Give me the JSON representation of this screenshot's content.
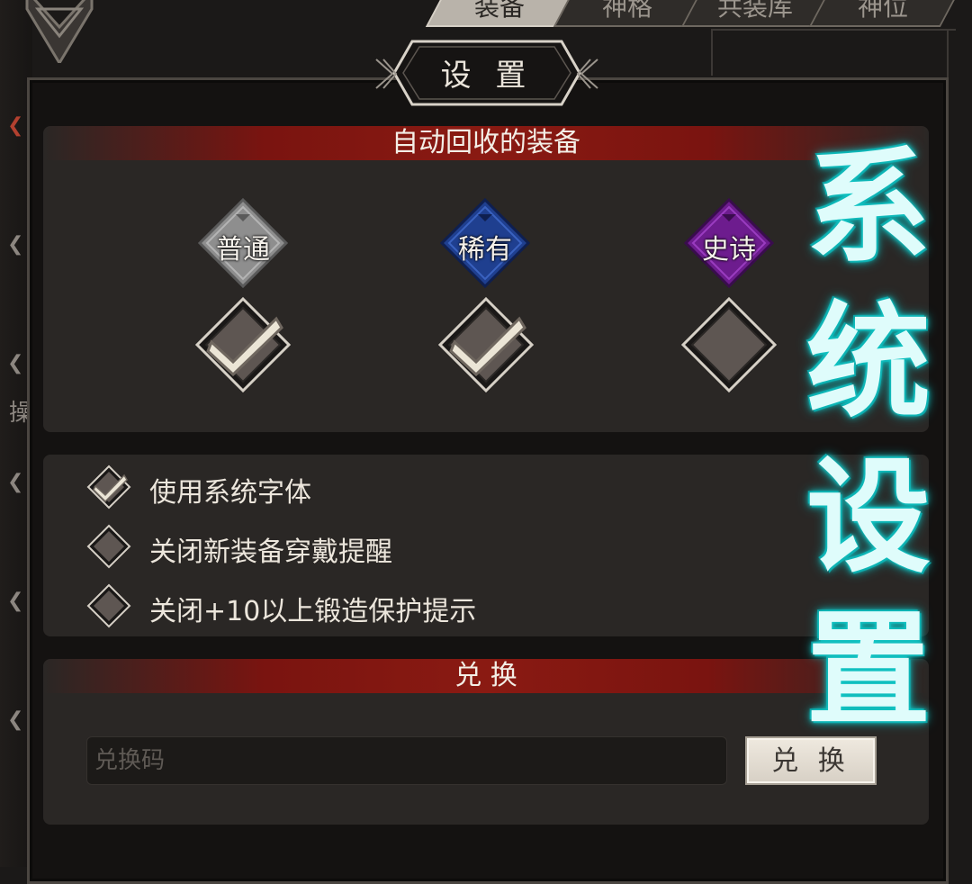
{
  "top_tabs": [
    "装备",
    "神格",
    "共装库",
    "神位"
  ],
  "dialog": {
    "title": "设 置"
  },
  "auto_recycle": {
    "header": "自动回收的装备",
    "rarities": [
      {
        "label": "普通",
        "color": "#8e8e8e",
        "checked": true
      },
      {
        "label": "稀有",
        "color": "#1f3f8f",
        "checked": true
      },
      {
        "label": "史诗",
        "color": "#6d1c8e",
        "checked": false
      }
    ]
  },
  "options": [
    {
      "label": "使用系统字体",
      "checked": true
    },
    {
      "label": "关闭新装备穿戴提醒",
      "checked": false
    },
    {
      "label": "关闭+10以上锻造保护提示",
      "checked": false
    }
  ],
  "redeem": {
    "header": "兑 换",
    "placeholder": "兑换码",
    "button_label": "兑 换"
  },
  "overlay_caption": [
    "系",
    "统",
    "设",
    "置"
  ],
  "side_char": "操",
  "colors": {
    "accent_red": "#7a1410",
    "caption_glow": "#13c7c6"
  }
}
